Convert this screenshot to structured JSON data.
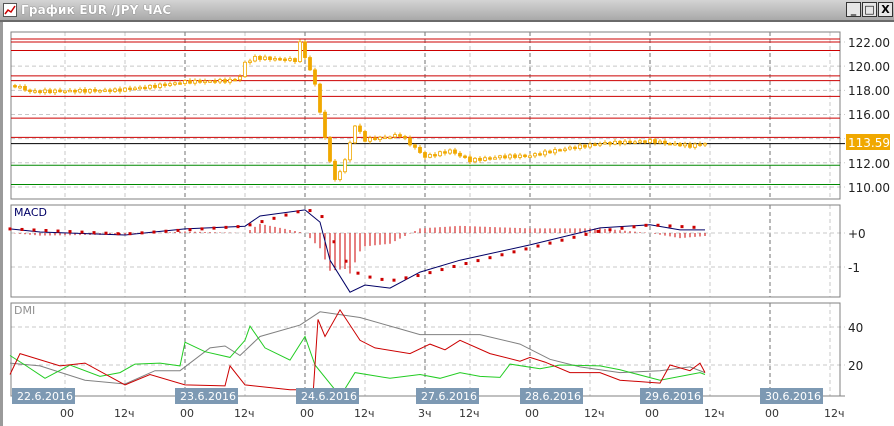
{
  "window": {
    "title": "График EUR /JPY  ЧАС",
    "minimize_label": "_",
    "maximize_label": "□",
    "close_label": "X"
  },
  "price_panel": {
    "y_ticks": [
      "122.00",
      "120.00",
      "118.00",
      "116.00",
      "112.00",
      "110.00"
    ],
    "current_price": "113.59"
  },
  "macd_panel": {
    "label": "MACD",
    "y_ticks": [
      "+0",
      "-1"
    ]
  },
  "dmi_panel": {
    "label": "DMI",
    "y_ticks": [
      "40",
      "20"
    ]
  },
  "time_axis": {
    "dates": [
      "22.6.2016",
      "23.6.2016",
      "24.6.2016",
      "27.6.2016",
      "28.6.2016",
      "29.6.2016",
      "30.6.2016"
    ],
    "times": [
      "00",
      "12ч",
      "00",
      "12ч",
      "00",
      "12ч",
      "3ч",
      "12ч",
      "00",
      "12ч",
      "00",
      "12ч",
      "00",
      "12ч"
    ]
  },
  "colors": {
    "candle": "#f0a800",
    "resistance": "#cc0000",
    "support": "#008800",
    "current": "#000000",
    "macd": "#000066",
    "signal": "#cc0000",
    "adx": "#808080",
    "di_minus": "#cc0000",
    "di_plus": "#22cc22",
    "accent": "#f0a800"
  },
  "chart_data": [
    {
      "type": "candlestick",
      "title": "EUR/JPY hourly",
      "x_unit": "hours from 22.6.2016 00:00",
      "ylim": [
        109,
        123
      ],
      "price_keypoints": [
        [
          -10,
          118.4
        ],
        [
          -7,
          117.9
        ],
        [
          10,
          118.0
        ],
        [
          17,
          118.3
        ],
        [
          24,
          118.7
        ],
        [
          33,
          118.8
        ],
        [
          35,
          119.1
        ],
        [
          36,
          120.3
        ],
        [
          38,
          120.7
        ],
        [
          46,
          120.5
        ],
        [
          47,
          121.9
        ],
        [
          48,
          120.8
        ],
        [
          50,
          118.5
        ],
        [
          52,
          114.0
        ],
        [
          54,
          110.5
        ],
        [
          56,
          112.2
        ],
        [
          58,
          115.1
        ],
        [
          60,
          113.9
        ],
        [
          67,
          114.3
        ],
        [
          72,
          112.5
        ],
        [
          77,
          113.0
        ],
        [
          81,
          112.2
        ],
        [
          87,
          112.5
        ],
        [
          93,
          112.6
        ],
        [
          99,
          113.1
        ],
        [
          107,
          113.6
        ],
        [
          117,
          113.8
        ],
        [
          121,
          113.6
        ],
        [
          125,
          113.4
        ],
        [
          128,
          113.6
        ]
      ],
      "resistance_levels": [
        122.25,
        122.0,
        121.3,
        119.2,
        118.8,
        117.5,
        115.7,
        114.1
      ],
      "support_levels": [
        111.8,
        110.2
      ],
      "current": 113.59
    },
    {
      "type": "line",
      "title": "MACD",
      "ylim": [
        -1.9,
        0.8
      ],
      "series": [
        {
          "name": "MACD",
          "points": [
            [
              -11,
              0.12
            ],
            [
              -5,
              0.03
            ],
            [
              12,
              -0.06
            ],
            [
              24,
              0.12
            ],
            [
              36,
              0.2
            ],
            [
              39,
              0.5
            ],
            [
              48,
              0.68
            ],
            [
              51,
              0.32
            ],
            [
              53,
              -0.8
            ],
            [
              57,
              -1.74
            ],
            [
              60,
              -1.53
            ],
            [
              65,
              -1.62
            ],
            [
              71,
              -1.15
            ],
            [
              79,
              -0.8
            ],
            [
              93,
              -0.35
            ],
            [
              107,
              0.15
            ],
            [
              117,
              0.24
            ],
            [
              123,
              0.09
            ],
            [
              128,
              0.09
            ]
          ]
        },
        {
          "name": "Signal",
          "points": [
            [
              -11,
              0.12
            ],
            [
              12,
              -0.03
            ],
            [
              24,
              0.09
            ],
            [
              36,
              0.2
            ],
            [
              48,
              0.68
            ],
            [
              51,
              0.62
            ],
            [
              53,
              -0.06
            ],
            [
              56,
              -0.8
            ],
            [
              59,
              -1.24
            ],
            [
              65,
              -1.41
            ],
            [
              71,
              -1.24
            ],
            [
              79,
              -0.94
            ],
            [
              93,
              -0.44
            ],
            [
              107,
              0.06
            ],
            [
              117,
              0.24
            ],
            [
              128,
              0.15
            ]
          ]
        }
      ]
    },
    {
      "type": "line",
      "title": "DMI",
      "ylim": [
        0,
        55
      ],
      "series": [
        {
          "name": "ADX",
          "points": [
            [
              -11,
              21
            ],
            [
              -5,
              19.5
            ],
            [
              4,
              12
            ],
            [
              12,
              10
            ],
            [
              18,
              17
            ],
            [
              23,
              17
            ],
            [
              29,
              29
            ],
            [
              32,
              30
            ],
            [
              35,
              25
            ],
            [
              39,
              35
            ],
            [
              47,
              41
            ],
            [
              51,
              48
            ],
            [
              59,
              45
            ],
            [
              67,
              39
            ],
            [
              71,
              36
            ],
            [
              83,
              36
            ],
            [
              91,
              31
            ],
            [
              97,
              23
            ],
            [
              103,
              19
            ],
            [
              111,
              16
            ],
            [
              119,
              17
            ],
            [
              125,
              19
            ],
            [
              128,
              16
            ]
          ]
        },
        {
          "name": "-DI",
          "points": [
            [
              -11,
              15
            ],
            [
              -9,
              26
            ],
            [
              -1,
              19.5
            ],
            [
              4,
              21
            ],
            [
              12,
              9.5
            ],
            [
              17,
              15
            ],
            [
              24,
              9.5
            ],
            [
              32,
              9
            ],
            [
              33,
              19.5
            ],
            [
              36,
              9.5
            ],
            [
              45,
              7
            ],
            [
              49,
              7
            ],
            [
              49.5,
              0
            ],
            [
              50.6,
              44
            ],
            [
              52,
              35
            ],
            [
              55,
              49
            ],
            [
              59,
              33
            ],
            [
              62,
              29
            ],
            [
              69,
              26
            ],
            [
              73,
              31
            ],
            [
              76,
              28
            ],
            [
              79,
              33
            ],
            [
              85,
              26
            ],
            [
              91,
              22
            ],
            [
              93,
              24
            ],
            [
              96,
              21.5
            ],
            [
              101,
              16
            ],
            [
              107,
              16
            ],
            [
              111,
              12
            ],
            [
              119,
              10.5
            ],
            [
              121,
              20
            ],
            [
              125,
              17
            ],
            [
              127,
              21
            ],
            [
              128,
              16
            ]
          ]
        },
        {
          "name": "+DI",
          "points": [
            [
              -11,
              25
            ],
            [
              -8,
              20
            ],
            [
              -4,
              13
            ],
            [
              1,
              20
            ],
            [
              7,
              14
            ],
            [
              11,
              16
            ],
            [
              14,
              20.5
            ],
            [
              19,
              21
            ],
            [
              23,
              19.5
            ],
            [
              24,
              32
            ],
            [
              28,
              27
            ],
            [
              33,
              24
            ],
            [
              36,
              33
            ],
            [
              37,
              40.5
            ],
            [
              40,
              29
            ],
            [
              45,
              22.6
            ],
            [
              48,
              35
            ],
            [
              50,
              20
            ],
            [
              54,
              7
            ],
            [
              56,
              7.5
            ],
            [
              58,
              16
            ],
            [
              65,
              13
            ],
            [
              71,
              15
            ],
            [
              75,
              13
            ],
            [
              79,
              16
            ],
            [
              83,
              14
            ],
            [
              87,
              13.5
            ],
            [
              89,
              20.5
            ],
            [
              95,
              18
            ],
            [
              99,
              20
            ],
            [
              107,
              19.5
            ],
            [
              111,
              17.5
            ],
            [
              119,
              12
            ],
            [
              127,
              16
            ],
            [
              128,
              15
            ]
          ]
        }
      ]
    }
  ]
}
